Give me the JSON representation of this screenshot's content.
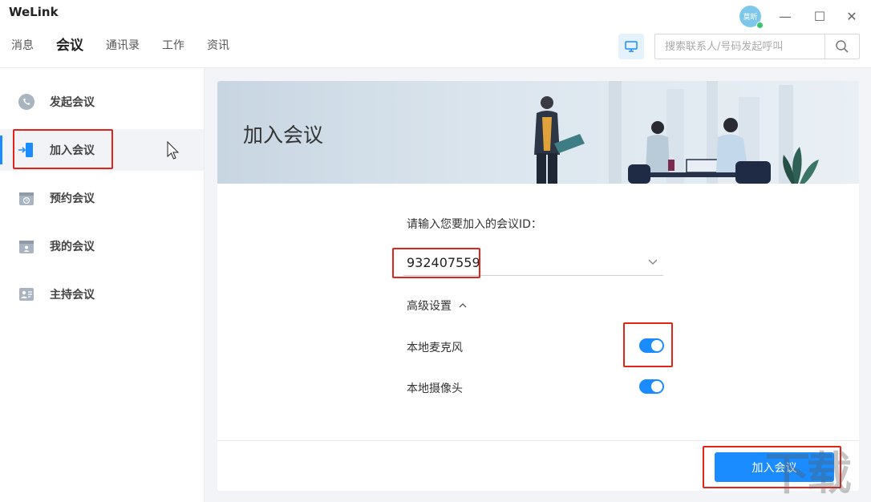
{
  "app": {
    "title": "WeLink",
    "avatar_text": "莫昕"
  },
  "window_controls": {
    "minimize": "—",
    "maximize": "☐",
    "close": "✕"
  },
  "nav": {
    "items": [
      "消息",
      "会议",
      "通讯录",
      "工作",
      "资讯"
    ],
    "active": "会议"
  },
  "search": {
    "placeholder": "搜索联系人/号码发起呼叫"
  },
  "sidebar": {
    "items": [
      {
        "label": "发起会议",
        "icon": "phone-bubble-icon"
      },
      {
        "label": "加入会议",
        "icon": "door-enter-icon",
        "active": true
      },
      {
        "label": "预约会议",
        "icon": "calendar-clock-icon"
      },
      {
        "label": "我的会议",
        "icon": "calendar-person-icon"
      },
      {
        "label": "主持会议",
        "icon": "host-icon"
      }
    ]
  },
  "join": {
    "banner_title": "加入会议",
    "id_label": "请输入您要加入的会议ID：",
    "meeting_id": "932407559",
    "advanced_label": "高级设置",
    "mic_label": "本地麦克风",
    "mic_on": true,
    "camera_label": "本地摄像头",
    "camera_on": true,
    "join_button": "加入会议"
  },
  "watermark": "下载",
  "colors": {
    "accent": "#1a8cff",
    "highlight": "#e2231a"
  }
}
